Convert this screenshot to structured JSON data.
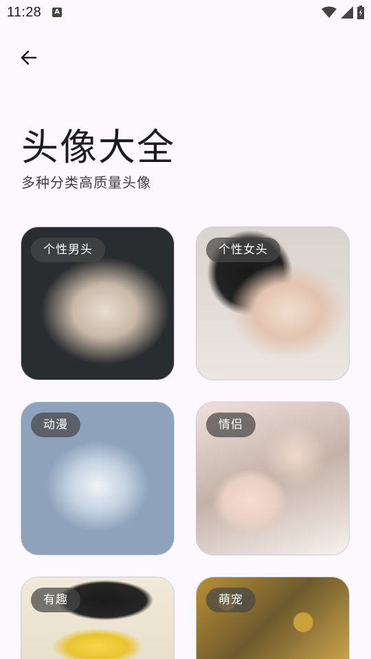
{
  "status_bar": {
    "time": "11:28",
    "notification_icon": "a-letter-icon",
    "icons": [
      "wifi-icon",
      "cellular-signal-icon",
      "battery-icon"
    ]
  },
  "header": {
    "back_icon": "arrow-left-icon"
  },
  "page": {
    "title": "头像大全",
    "subtitle": "多种分类高质量头像"
  },
  "categories": [
    {
      "label": "个性男头"
    },
    {
      "label": "个性女头"
    },
    {
      "label": "动漫"
    },
    {
      "label": "情侣"
    },
    {
      "label": "有趣"
    },
    {
      "label": "萌宠"
    }
  ],
  "colors": {
    "background": "#fcf8fd",
    "text": "#1c1b1f",
    "label_chip": "#464646"
  }
}
